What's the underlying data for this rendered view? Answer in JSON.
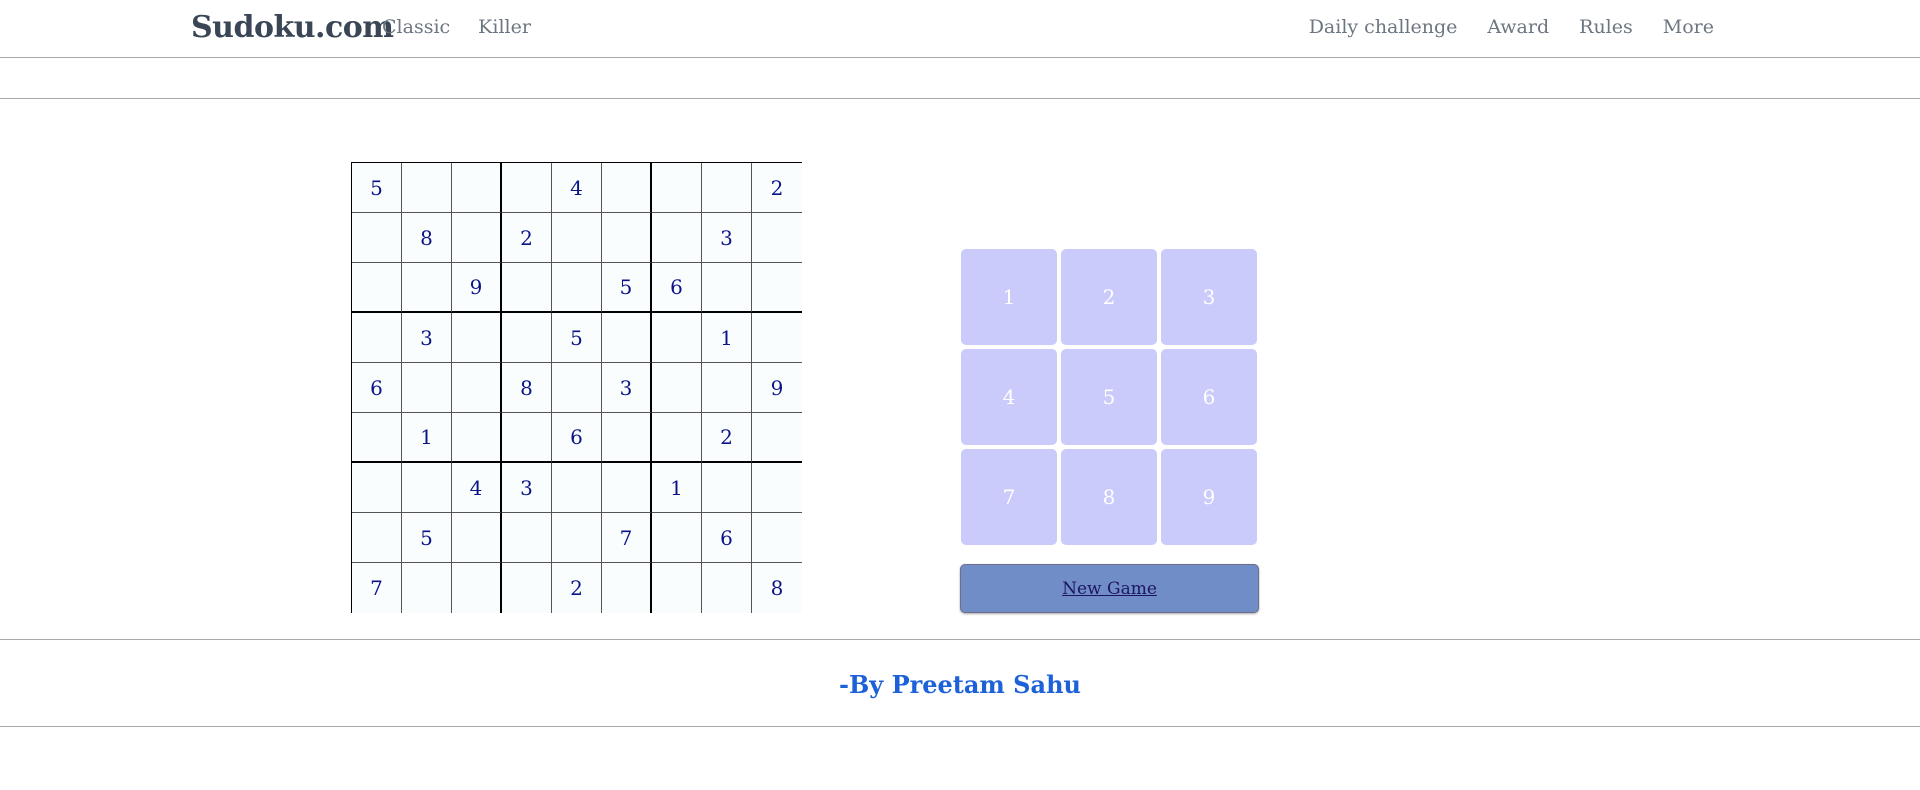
{
  "navbar": {
    "brand": "Sudoku.com",
    "left_links": [
      "Classic",
      "Killer"
    ],
    "right_links": [
      "Daily challenge",
      "Award",
      "Rules",
      "More"
    ]
  },
  "board": {
    "rows": [
      [
        "5",
        "",
        "",
        "",
        "4",
        "",
        "",
        "",
        "2"
      ],
      [
        "",
        "8",
        "",
        "2",
        "",
        "",
        "",
        "3",
        ""
      ],
      [
        "",
        "",
        "9",
        "",
        "",
        "5",
        "6",
        "",
        ""
      ],
      [
        "",
        "3",
        "",
        "",
        "5",
        "",
        "",
        "1",
        ""
      ],
      [
        "6",
        "",
        "",
        "8",
        "",
        "3",
        "",
        "",
        "9"
      ],
      [
        "",
        "1",
        "",
        "",
        "6",
        "",
        "",
        "2",
        ""
      ],
      [
        "",
        "",
        "4",
        "3",
        "",
        "",
        "1",
        "",
        ""
      ],
      [
        "",
        "5",
        "",
        "",
        "",
        "7",
        "",
        "6",
        ""
      ],
      [
        "7",
        "",
        "",
        "",
        "2",
        "",
        "",
        "",
        "8"
      ]
    ]
  },
  "keypad": {
    "keys": [
      "1",
      "2",
      "3",
      "4",
      "5",
      "6",
      "7",
      "8",
      "9"
    ]
  },
  "new_game_label": "New Game",
  "footer": {
    "credit": "-By Preetam Sahu"
  },
  "colors": {
    "cell_digit": "#0b1487",
    "keypad_bg": "#cbcbfb",
    "new_game_bg": "#718dc8",
    "credit": "#1d61d9"
  }
}
